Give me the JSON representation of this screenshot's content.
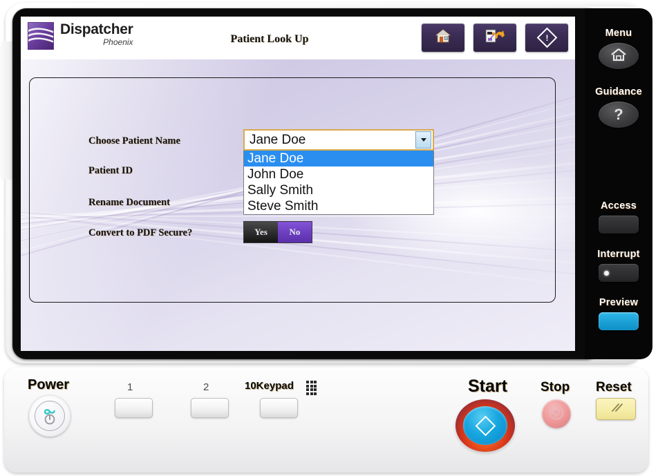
{
  "app": {
    "logo_title": "Dispatcher",
    "logo_subtitle": "Phoenix",
    "title": "Patient Look Up"
  },
  "header_buttons": [
    {
      "name": "home-button",
      "icon": "home-icon",
      "label": "Home"
    },
    {
      "name": "workflow-back-button",
      "icon": "document-undo-icon",
      "label": "Back"
    },
    {
      "name": "start-job-button",
      "icon": "diamond-start-icon",
      "label": "Start"
    }
  ],
  "form": {
    "fields": [
      {
        "label": "Choose Patient Name",
        "type": "dropdown"
      },
      {
        "label": "Patient ID",
        "type": "text"
      },
      {
        "label": "Rename Document",
        "type": "text"
      },
      {
        "label": "Convert to PDF Secure?",
        "type": "toggle"
      }
    ],
    "patient_name": {
      "selected": "Jane Doe",
      "options": [
        "Jane Doe",
        "John Doe",
        "Sally Smith",
        "Steve Smith"
      ],
      "selected_index": 0
    },
    "pdf_secure": {
      "yes_label": "Yes",
      "no_label": "No",
      "selected": "No"
    }
  },
  "side_keys": [
    {
      "label": "Menu",
      "icon": "home-icon",
      "shape": "oval"
    },
    {
      "label": "Guidance",
      "icon": "question-mark-icon",
      "shape": "oval"
    },
    {
      "label": "Access",
      "icon": "blank-icon",
      "shape": "rect"
    },
    {
      "label": "Interrupt",
      "icon": "indicator-dot-icon",
      "shape": "rect"
    },
    {
      "label": "Preview",
      "icon": "blank-icon",
      "shape": "rect-cyan"
    }
  ],
  "control_panel": {
    "power_label": "Power",
    "power_icon": "eco-power-icon",
    "numeric_buttons": [
      {
        "label": "1"
      },
      {
        "label": "2"
      }
    ],
    "keypad_label": "10Keypad",
    "keypad_icon": "keypad-grid-icon",
    "start_label": "Start",
    "start_icon": "diamond-start-icon",
    "stop_label": "Stop",
    "stop_icon": "stop-triangle-icon",
    "reset_label": "Reset",
    "reset_icon": "double-slash-icon"
  },
  "colors": {
    "accent_purple": "#5a2fab",
    "highlight_blue": "#2a8ef0",
    "combo_border": "#d8a94a",
    "preview_cyan": "#0c8fc6",
    "reset_yellow": "#f5eda8"
  }
}
